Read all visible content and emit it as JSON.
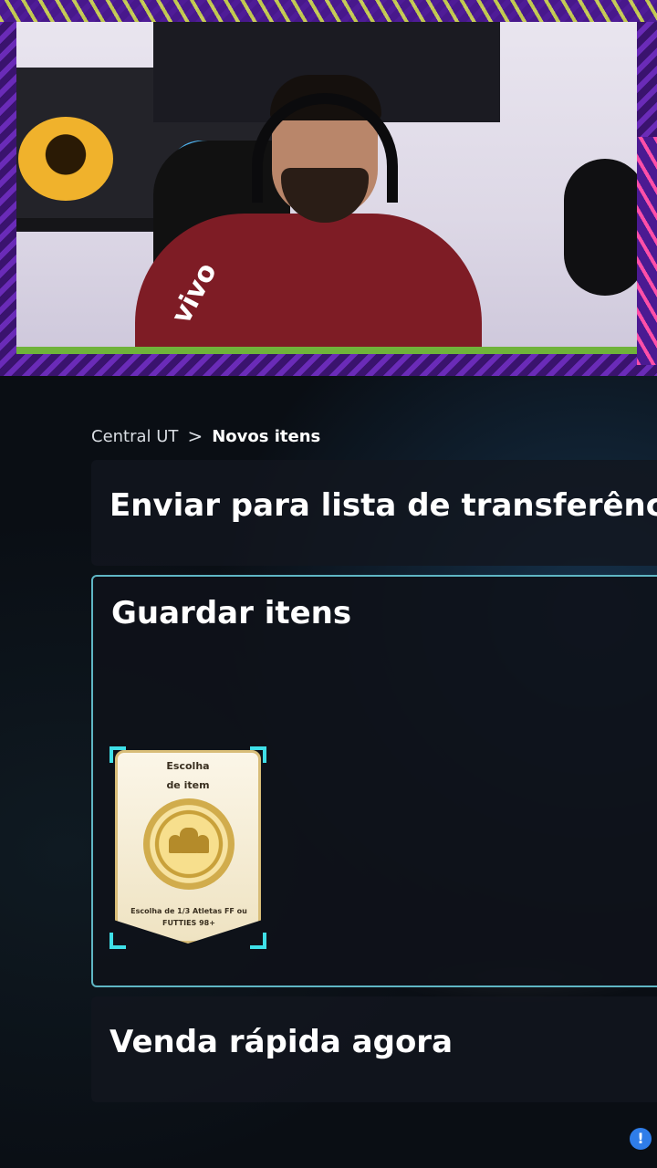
{
  "breadcrumb": {
    "parent": "Central UT",
    "current": "Novos itens"
  },
  "options": {
    "send_label": "Enviar para lista de transferênc",
    "keep_label": "Guardar itens",
    "sell_label": "Venda rápida agora"
  },
  "item_card": {
    "title_line1": "Escolha",
    "title_line2": "de item",
    "description": "Escolha de 1/3 Atletas FF ou FUTTIES 98+"
  },
  "webcam": {
    "shirt_text": "vivo"
  },
  "colors": {
    "accent_border": "#5fb6c4",
    "selection_corners": "#3fe0e8",
    "card_gold": "#d8bd78"
  }
}
